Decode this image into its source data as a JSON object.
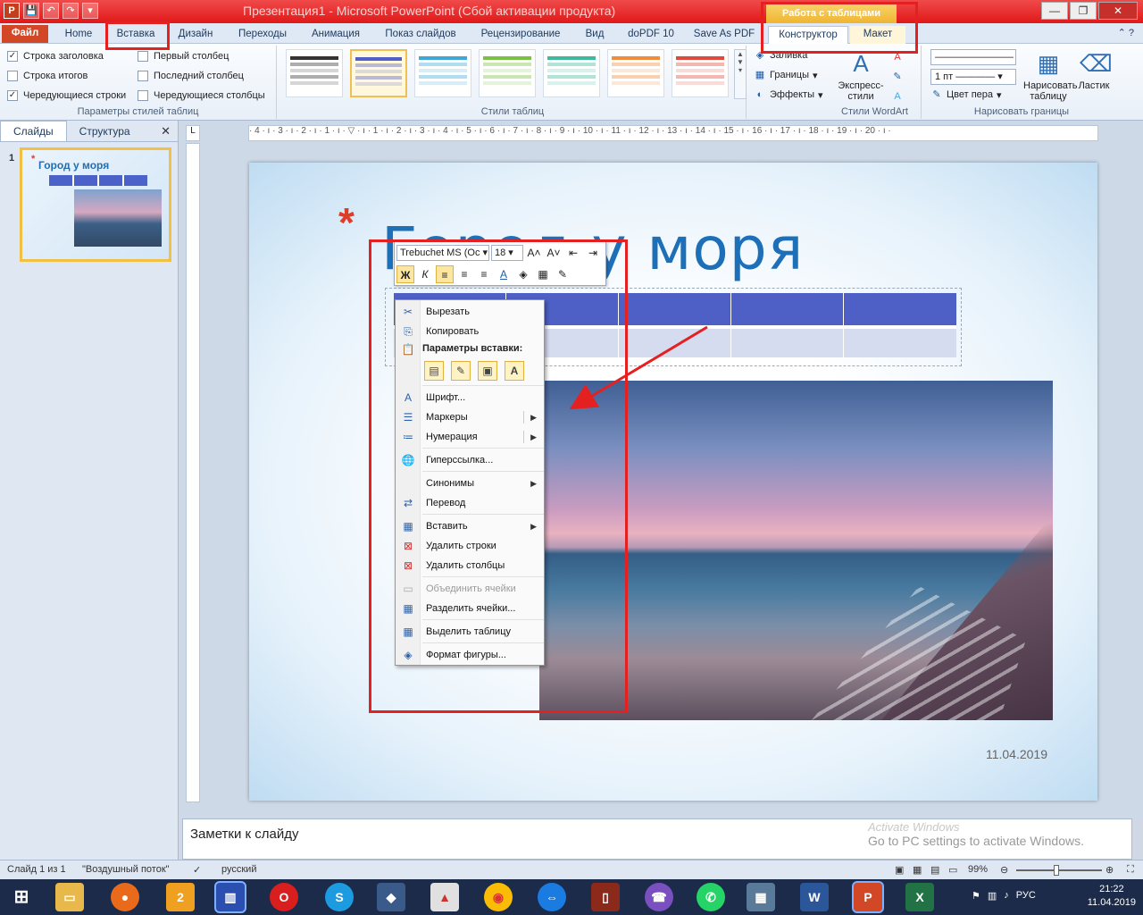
{
  "titlebar": {
    "title": "Презентация1 - Microsoft PowerPoint (Сбой активации продукта)",
    "context_group": "Работа с таблицами",
    "minimize": "—",
    "restore": "❐",
    "close": "✕",
    "qat": {
      "app": "P",
      "save": "💾",
      "undo": "↶",
      "redo": "↷",
      "customize": "▾"
    }
  },
  "tabs": {
    "file": "Файл",
    "home": "Home",
    "insert": "Вставка",
    "design": "Дизайн",
    "transitions": "Переходы",
    "animations": "Анимация",
    "slideshow": "Показ слайдов",
    "review": "Рецензирование",
    "view": "Вид",
    "dopdf": "doPDF 10",
    "saveaspdf": "Save As PDF",
    "constructor": "Конструктор",
    "layout": "Макет",
    "help": "⌃ ?"
  },
  "ribbon": {
    "table_style_options": {
      "label": "Параметры стилей таблиц",
      "header_row": "Строка заголовка",
      "total_row": "Строка итогов",
      "banded_rows": "Чередующиеся строки",
      "first_column": "Первый столбец",
      "last_column": "Последний столбец",
      "banded_columns": "Чередующиеся столбцы",
      "checked_mark": "✓"
    },
    "table_styles": {
      "label": "Стили таблиц",
      "swatch_colors": [
        "#333333",
        "#4e60c6",
        "#3fa7d6",
        "#79c142",
        "#3fb99e",
        "#f08c3c",
        "#e04a3c"
      ],
      "fill": "Заливка",
      "borders": "Границы",
      "effects": "Эффекты"
    },
    "wordart": {
      "label": "Стили WordArt",
      "express": "Экспресс-стили"
    },
    "draw_borders": {
      "label": "Нарисовать границы",
      "pen_weight": "1 пт",
      "pen_color": "Цвет пера",
      "draw_table": "Нарисовать таблицу",
      "eraser": "Ластик"
    }
  },
  "panel": {
    "tab_slides": "Слайды",
    "tab_outline": "Структура",
    "close": "✕",
    "slide_number": "1",
    "thumb_title": "Город у моря"
  },
  "ruler": {
    "corner": "L",
    "h_marks": "· 4 · ı · 3 · ı · 2 · ı · 1 · ı · ▽ · ı · 1 · ı · 2 · ı · 3 · ı · 4 · ı · 5 · ı · 6 · ı · 7 · ı · 8 · ı · 9 · ı · 10 · ı · 11 · ı · 12 · ı · 13 · ı · 14 · ı · 15 · ı · 16 · ı · 17 · ı · 18 · ı · 19 · ı · 20 · ı ·"
  },
  "slide": {
    "star": "*",
    "title": "Город у моря",
    "date": "11.04.2019"
  },
  "minitoolbar": {
    "font": "Trebuchet MS (Oc",
    "size": "18",
    "grow": "A˄",
    "shrink": "A˅",
    "bold": "Ж",
    "italic": "К",
    "align_left": "≡",
    "center": "≡",
    "align_right": "≡",
    "font_color": "A",
    "fill": "◈",
    "borders": "▦",
    "painter": "✎"
  },
  "contextmenu": {
    "cut": "Вырезать",
    "copy": "Копировать",
    "paste_options": "Параметры вставки:",
    "font": "Шрифт...",
    "bullets": "Маркеры",
    "numbering": "Нумерация",
    "hyperlink": "Гиперссылка...",
    "synonyms": "Синонимы",
    "translate": "Перевод",
    "insert": "Вставить",
    "delete_rows": "Удалить строки",
    "delete_cols": "Удалить столбцы",
    "merge_cells": "Объединить ячейки",
    "split_cells": "Разделить ячейки...",
    "select_table": "Выделить таблицу",
    "format_shape": "Формат фигуры..."
  },
  "notes": {
    "placeholder": "Заметки к слайду",
    "watermark_line1": "Activate Windows",
    "watermark_line2": "Go to PC settings to activate Windows."
  },
  "statusbar": {
    "slide_info": "Слайд 1 из 1",
    "theme": "\"Воздушный поток\"",
    "language": "русский",
    "zoom": "99%",
    "zoom_out": "⊖",
    "zoom_in": "⊕"
  },
  "taskbar": {
    "lang": "РУС",
    "time": "21:22",
    "date": "11.04.2019"
  },
  "colors": {
    "annotation_red": "#e52020",
    "table_header": "#4e60c6",
    "title_blue": "#1d6fb8"
  }
}
